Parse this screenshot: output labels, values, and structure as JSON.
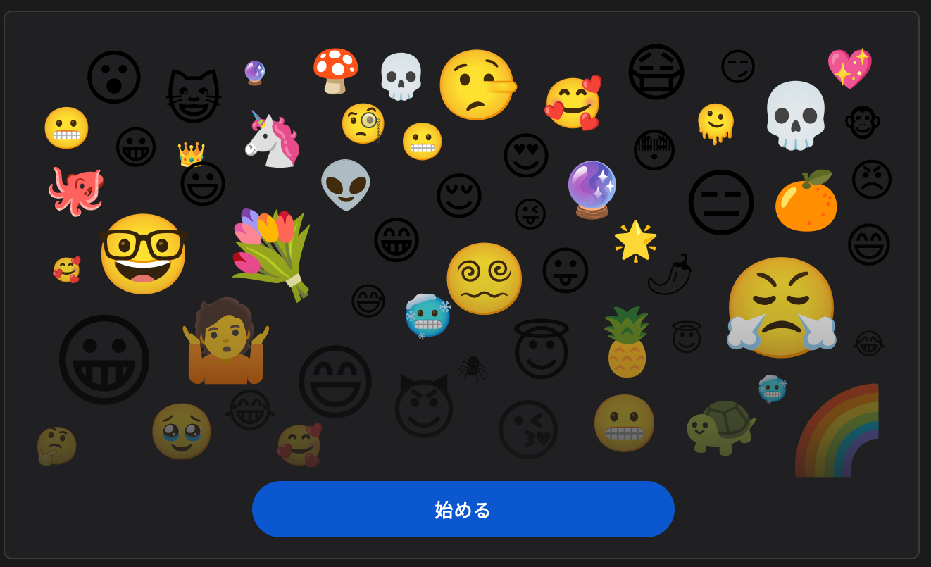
{
  "start_button": {
    "label": "始める"
  },
  "collage": {
    "emojis": [
      {
        "name": "open-mouth-icon",
        "char": "😮"
      },
      {
        "name": "grinning-cat-icon",
        "char": "😺"
      },
      {
        "name": "crystal-ball-small-icon",
        "char": "🔮"
      },
      {
        "name": "mushroom-icon",
        "char": "🍄"
      },
      {
        "name": "skull-small-icon",
        "char": "💀"
      },
      {
        "name": "lying-face-icon",
        "char": "🤥"
      },
      {
        "name": "mask-face-icon",
        "char": "😷"
      },
      {
        "name": "smirk-face-icon",
        "char": "😏"
      },
      {
        "name": "sparkling-heart-icon",
        "char": "💖"
      },
      {
        "name": "grimacing-face-small-icon",
        "char": "😬"
      },
      {
        "name": "unicorn-icon",
        "char": "🦄"
      },
      {
        "name": "monocle-face-icon",
        "char": "🧐"
      },
      {
        "name": "smiling-hearts-face-icon",
        "char": "🥰"
      },
      {
        "name": "skull-large-icon",
        "char": "💀"
      },
      {
        "name": "melting-face-icon",
        "char": "🫠"
      },
      {
        "name": "monkey-face-icon",
        "char": "🐵"
      },
      {
        "name": "smiling-face-icon",
        "char": "😀"
      },
      {
        "name": "crown-icon",
        "char": "👑"
      },
      {
        "name": "grinning-face-crown-icon",
        "char": "😃"
      },
      {
        "name": "grimacing-face-icon",
        "char": "😬"
      },
      {
        "name": "heart-eyes-icon",
        "char": "😍"
      },
      {
        "name": "flushed-face-icon",
        "char": "😳"
      },
      {
        "name": "octopus-icon",
        "char": "🐙"
      },
      {
        "name": "alien-icon",
        "char": "👽"
      },
      {
        "name": "relieved-face-icon",
        "char": "😌"
      },
      {
        "name": "crystal-ball-icon",
        "char": "🔮"
      },
      {
        "name": "expressionless-face-icon",
        "char": "😑"
      },
      {
        "name": "tangerine-icon",
        "char": "🍊"
      },
      {
        "name": "angry-face-icon",
        "char": "😠"
      },
      {
        "name": "winking-tongue-icon",
        "char": "😜"
      },
      {
        "name": "nerd-face-icon",
        "char": "🤓"
      },
      {
        "name": "bouquet-icon",
        "char": "💐"
      },
      {
        "name": "pensive-grin-icon",
        "char": "😁"
      },
      {
        "name": "star-icon",
        "char": "🌟"
      },
      {
        "name": "grinning-squint-icon",
        "char": "😄"
      },
      {
        "name": "pepper-icon",
        "char": "🌶"
      },
      {
        "name": "smiling-hearts-small-icon",
        "char": "🥰"
      },
      {
        "name": "dizzy-face-icon",
        "char": "😵‍💫"
      },
      {
        "name": "tongue-out-icon",
        "char": "😛"
      },
      {
        "name": "triumph-face-icon",
        "char": "😤"
      },
      {
        "name": "sweat-grin-icon",
        "char": "😅"
      },
      {
        "name": "cold-face-icon",
        "char": "🥶"
      },
      {
        "name": "grinning-eyes-icon",
        "char": "😀"
      },
      {
        "name": "halo-face-icon",
        "char": "😇"
      },
      {
        "name": "pineapple-icon",
        "char": "🍍"
      },
      {
        "name": "tears-of-joy-icon",
        "char": "😂"
      },
      {
        "name": "halo-small-icon",
        "char": "😇"
      },
      {
        "name": "shrug-blob-icon",
        "char": "🤷"
      },
      {
        "name": "beaming-face-icon",
        "char": "😄"
      },
      {
        "name": "spider-icon",
        "char": "🕷"
      },
      {
        "name": "tears-grin-icon",
        "char": "😂"
      },
      {
        "name": "cold-face-small-icon",
        "char": "🥶"
      },
      {
        "name": "devil-grin-icon",
        "char": "😈"
      },
      {
        "name": "kissing-heart-icon",
        "char": "😘"
      },
      {
        "name": "grimace-closed-icon",
        "char": "😬"
      },
      {
        "name": "turtle-icon",
        "char": "🐢"
      },
      {
        "name": "rainbow-icon",
        "char": "🌈"
      },
      {
        "name": "thinking-face-icon",
        "char": "🤔"
      },
      {
        "name": "holding-tears-icon",
        "char": "🥹"
      },
      {
        "name": "hearts-grin-icon",
        "char": "🥰"
      },
      {
        "name": "pleading-face-icon",
        "char": "🥺"
      }
    ]
  }
}
